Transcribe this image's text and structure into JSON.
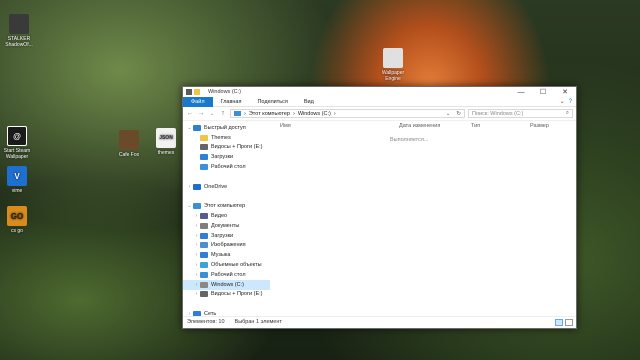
{
  "desktop": {
    "icons": [
      {
        "label": "STALKER ShadowOf...",
        "glyph": "",
        "color": "#3a3a3a"
      },
      {
        "label": "Wallpaper Engine",
        "glyph": "",
        "color": "#e0e0e0"
      },
      {
        "label": "Start Steam Wallpaper",
        "glyph": "@",
        "color": "#1b1b1b"
      },
      {
        "label": "Cafe Fox",
        "glyph": "",
        "color": "#6b4a2a"
      },
      {
        "label": "themes",
        "glyph": "JSON",
        "color": "#f2f2f2"
      },
      {
        "label": "vime",
        "glyph": "V",
        "color": "#1d6fd0"
      },
      {
        "label": "cs go",
        "glyph": "GO",
        "color": "#d98c1b"
      }
    ]
  },
  "window": {
    "title": "Windows (C:)",
    "controls": {
      "minimize": "—",
      "maximize": "☐",
      "close": "✕"
    },
    "ribbon": {
      "tabs": [
        "Файл",
        "Главная",
        "Поделиться",
        "Вид"
      ],
      "expand": "⌄",
      "help": "?"
    },
    "address": {
      "back": "←",
      "forward": "→",
      "history": "⌄",
      "up": "↑",
      "path": [
        "Этот компьютер",
        "Windows (C:)"
      ],
      "refresh": "↻"
    },
    "search": {
      "placeholder": "Поиск: Windows (C:)",
      "icon": "⌕"
    },
    "nav": [
      {
        "label": "Быстрый доступ",
        "arrow": "⌄",
        "icon_color": "#2f7fd4"
      },
      {
        "label": "Themes",
        "arrow": "",
        "icon_color": "#f2c443"
      },
      {
        "label": "Видосы + Проги (E:)",
        "arrow": "",
        "icon_color": "#666"
      },
      {
        "label": "Загрузки",
        "arrow": "",
        "icon_color": "#2f7fd4"
      },
      {
        "label": "Рабочий стол",
        "arrow": "",
        "icon_color": "#3a8fd9"
      },
      {
        "label": "",
        "arrow": "",
        "icon_color": "transparent"
      },
      {
        "label": "OneDrive",
        "arrow": "›",
        "icon_color": "#1e6fd0"
      },
      {
        "label": "",
        "arrow": "",
        "icon_color": "transparent"
      },
      {
        "label": "Этот компьютер",
        "arrow": "⌄",
        "icon_color": "#3a8fd9"
      },
      {
        "label": "Видео",
        "arrow": "›",
        "icon_color": "#5a5a8a"
      },
      {
        "label": "Документы",
        "arrow": "›",
        "icon_color": "#7d7d7d"
      },
      {
        "label": "Загрузки",
        "arrow": "›",
        "icon_color": "#2f7fd4"
      },
      {
        "label": "Изображения",
        "arrow": "›",
        "icon_color": "#4c8fd0"
      },
      {
        "label": "Музыка",
        "arrow": "›",
        "icon_color": "#2f7fd4"
      },
      {
        "label": "Объемные объекты",
        "arrow": "›",
        "icon_color": "#3aa4d8"
      },
      {
        "label": "Рабочий стол",
        "arrow": "›",
        "icon_color": "#3a8fd9"
      },
      {
        "label": "Windows (C:)",
        "arrow": "›",
        "icon_color": "#888"
      },
      {
        "label": "Видосы + Проги (E:)",
        "arrow": "›",
        "icon_color": "#666"
      },
      {
        "label": "",
        "arrow": "",
        "icon_color": "transparent"
      },
      {
        "label": "Сеть",
        "arrow": "›",
        "icon_color": "#2f7fd4"
      }
    ],
    "columns": [
      "Имя",
      "Дата изменения",
      "Тип",
      "Размер"
    ],
    "loading_text": "Выполняется...",
    "status": {
      "items": "Элементов: 10",
      "selected": "Выбран 1 элемент"
    }
  }
}
